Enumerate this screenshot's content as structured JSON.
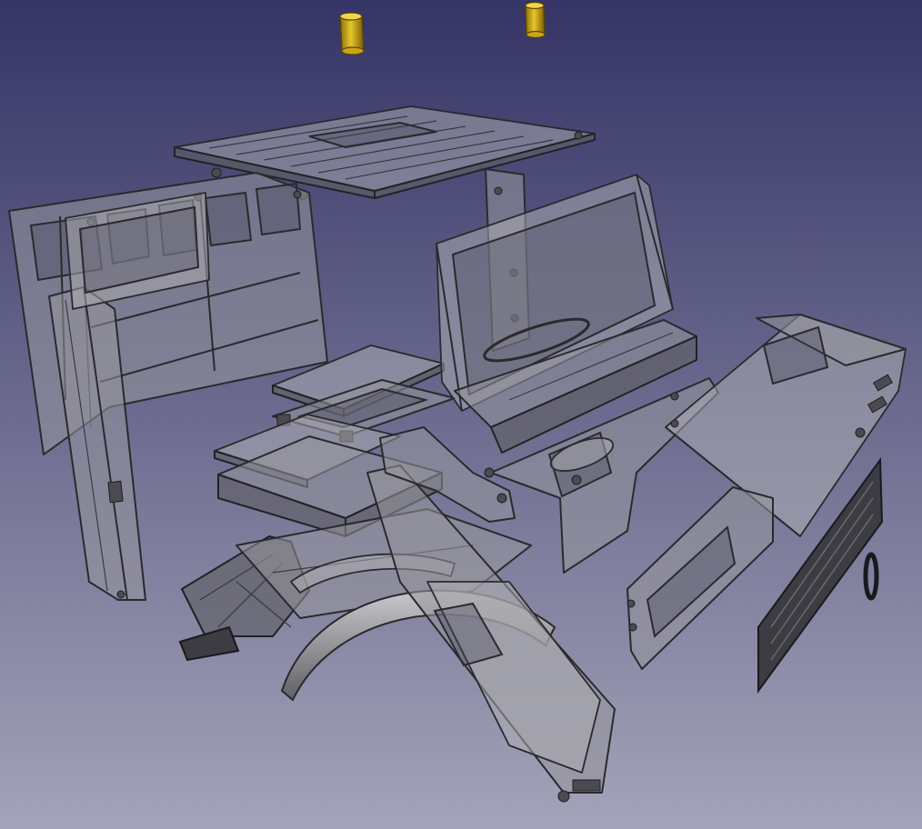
{
  "viewport": {
    "background_top": "#353466",
    "background_bottom": "#a3a3b9",
    "model_edge_color": "#2a2a2e",
    "model_face_color": "#96969c",
    "accent_part_color": "#d4b21e"
  }
}
